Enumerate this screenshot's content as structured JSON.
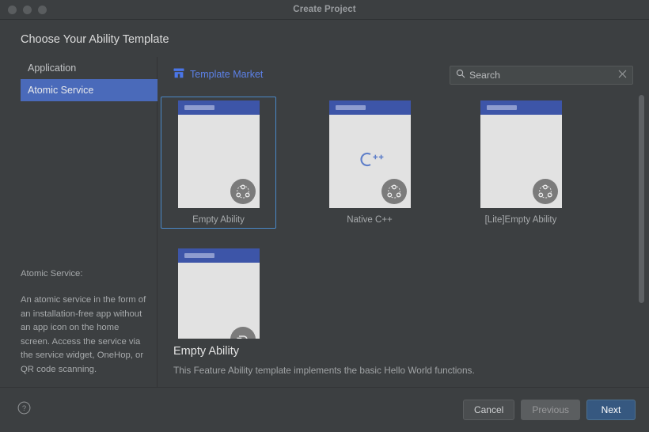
{
  "window": {
    "title": "Create Project",
    "traffic_lights": [
      "close-button",
      "minimize-button",
      "zoom-button"
    ]
  },
  "page_title": "Choose Your Ability Template",
  "sidebar": {
    "items": [
      {
        "label": "Application",
        "selected": false
      },
      {
        "label": "Atomic Service",
        "selected": true
      }
    ],
    "description_heading": "Atomic Service:",
    "description_body": "An atomic service in the form of an installation-free app without an app icon on the home screen. Access the service via the service widget, OneHop, or QR code scanning."
  },
  "market": {
    "link_label": "Template Market",
    "link_color": "#5c81e8",
    "icon": "shop-icon"
  },
  "search": {
    "value": "",
    "placeholder": "Search",
    "clear_label": "✕"
  },
  "templates": [
    {
      "name": "Empty Ability",
      "selected": true,
      "badge": "atomic-service-icon",
      "logo": ""
    },
    {
      "name": "Native C++",
      "selected": false,
      "badge": "atomic-service-icon",
      "logo": "C++"
    },
    {
      "name": "[Lite]Empty Ability",
      "selected": false,
      "badge": "atomic-service-icon",
      "logo": ""
    },
    {
      "name": "",
      "selected": false,
      "badge": "form-ability-icon",
      "logo": ""
    }
  ],
  "detail": {
    "title": "Empty Ability",
    "description": "This Feature Ability template implements the basic Hello World functions."
  },
  "footer": {
    "help": "?",
    "buttons": [
      {
        "label": "Cancel",
        "style": "normal"
      },
      {
        "label": "Previous",
        "style": "disabled"
      },
      {
        "label": "Next",
        "style": "primary"
      }
    ]
  },
  "colors": {
    "background": "#3c3f41",
    "accent_blue": "#4a6aba",
    "selection_border": "#4a88c7",
    "primary_button": "#365880",
    "phone_header": "#3d55a8"
  }
}
